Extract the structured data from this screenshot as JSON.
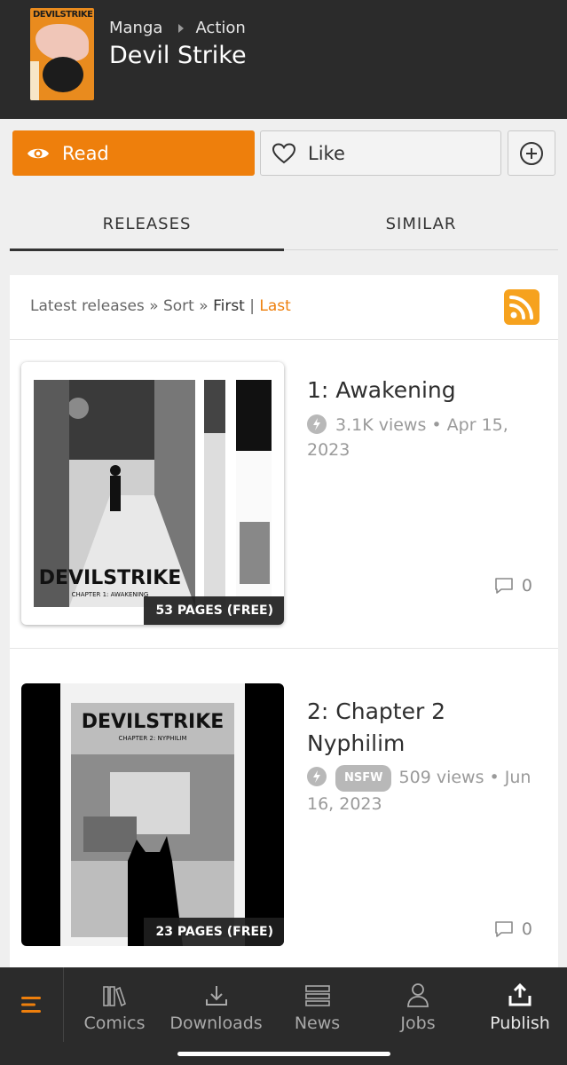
{
  "header": {
    "cover_text": "DEVILSTRIKE",
    "crumb_1": "Manga",
    "crumb_2": "Action",
    "title": "Devil Strike"
  },
  "actions": {
    "read_label": "Read",
    "like_label": "Like"
  },
  "tabs": [
    {
      "label": "RELEASES",
      "active": true
    },
    {
      "label": "SIMILAR",
      "active": false
    }
  ],
  "sortbar": {
    "prefix": "Latest releases » Sort » ",
    "first": "First",
    "separator": " | ",
    "last": "Last"
  },
  "releases": [
    {
      "title": "1: Awakening",
      "views": "3.1K views",
      "date": "Apr 15, 2023",
      "pages": "53 PAGES (FREE)",
      "comments": "0",
      "cover_text": "DEVILSTRIKE",
      "cover_sub": "CHAPTER 1: AWAKENING"
    },
    {
      "title": "2: Chapter 2 Nyphilim",
      "badge": "NSFW",
      "views": "509 views",
      "date": "Jun 16, 2023",
      "pages": "23 PAGES (FREE)",
      "comments": "0",
      "cover_text": "DEVILSTRIKE",
      "cover_sub": "CHAPTER 2: NYPHILIM"
    }
  ],
  "nav": {
    "comics": "Comics",
    "downloads": "Downloads",
    "news": "News",
    "jobs": "Jobs",
    "publish": "Publish"
  },
  "colors": {
    "accent": "#ee7f0c",
    "header_bg": "#2b2b2b",
    "rss": "#f6a21e"
  }
}
